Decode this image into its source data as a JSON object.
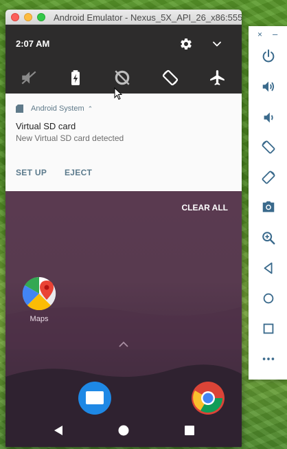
{
  "window": {
    "title": "Android Emulator - Nexus_5X_API_26_x86:5554"
  },
  "status": {
    "time": "2:07 AM"
  },
  "quick_settings": {
    "top_icons": [
      "settings-icon",
      "chevron-down-icon"
    ],
    "tiles": [
      "vibrate-off-icon",
      "battery-saver-icon",
      "data-saver-icon",
      "auto-rotate-icon",
      "airplane-mode-icon"
    ]
  },
  "notification": {
    "app_name": "Android System",
    "title": "Virtual SD card",
    "text": "New Virtual SD card detected",
    "actions": [
      "SET UP",
      "EJECT"
    ]
  },
  "home": {
    "clear_all": "CLEAR ALL",
    "apps": [
      {
        "label": "Maps",
        "icon": "maps-icon"
      }
    ],
    "dock": [
      "messages-icon",
      "chrome-icon"
    ],
    "nav": [
      "back-icon",
      "home-icon",
      "recents-icon"
    ]
  },
  "toolbar": {
    "window_buttons": [
      "close",
      "minimize"
    ],
    "close_glyph": "×",
    "minimize_glyph": "–",
    "buttons": [
      "power-icon",
      "volume-up-icon",
      "volume-down-icon",
      "rotate-left-icon",
      "rotate-right-icon",
      "camera-icon",
      "zoom-icon",
      "back-icon",
      "home-icon",
      "overview-icon",
      "more-icon"
    ]
  },
  "colors": {
    "notification_action": "#5b7a8c",
    "quick_settings_bg": "#2d2c2c",
    "toolbar_icon": "#3a6a8c"
  }
}
